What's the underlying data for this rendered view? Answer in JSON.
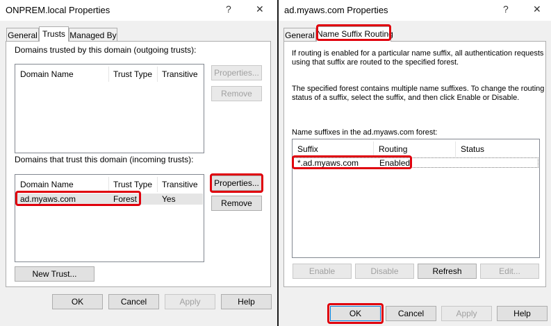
{
  "left_dialog": {
    "title": "ONPREM.local Properties",
    "help_glyph": "?",
    "close_glyph": "✕",
    "tabs": [
      "General",
      "Trusts",
      "Managed By"
    ],
    "outgoing": {
      "label": "Domains trusted by this domain (outgoing trusts):",
      "columns": [
        "Domain Name",
        "Trust Type",
        "Transitive"
      ],
      "properties_button": "Properties...",
      "remove_button": "Remove"
    },
    "incoming": {
      "label": "Domains that trust this domain (incoming trusts):",
      "columns": [
        "Domain Name",
        "Trust Type",
        "Transitive"
      ],
      "rows": [
        {
          "domain": "ad.myaws.com",
          "type": "Forest",
          "transitive": "Yes"
        }
      ],
      "properties_button": "Properties...",
      "remove_button": "Remove"
    },
    "new_trust_button": "New Trust...",
    "footer": {
      "ok": "OK",
      "cancel": "Cancel",
      "apply": "Apply",
      "help": "Help"
    }
  },
  "right_dialog": {
    "title": "ad.myaws.com Properties",
    "help_glyph": "?",
    "close_glyph": "✕",
    "tabs": [
      "General",
      "Name Suffix Routing"
    ],
    "description1_line1": "If routing is enabled for a particular name suffix, all authentication requests",
    "description1_line2": "using that suffix are routed to the specified forest.",
    "description2_line1": "The specified forest contains multiple name suffixes. To change the routing",
    "description2_line2": "status of a suffix, select the suffix, and then click Enable or Disable.",
    "list_label": "Name suffixes in the ad.myaws.com forest:",
    "columns": [
      "Suffix",
      "Routing",
      "Status"
    ],
    "rows": [
      {
        "suffix": "*.ad.myaws.com",
        "routing": "Enabled",
        "status": ""
      }
    ],
    "buttons": {
      "enable": "Enable",
      "disable": "Disable",
      "refresh": "Refresh",
      "edit": "Edit..."
    },
    "footer": {
      "ok": "OK",
      "cancel": "Cancel",
      "apply": "Apply",
      "help": "Help"
    }
  },
  "colors": {
    "highlight": "#e0000c",
    "dialog_bg": "#f0f0f0",
    "focus_blue": "#0078d7"
  }
}
